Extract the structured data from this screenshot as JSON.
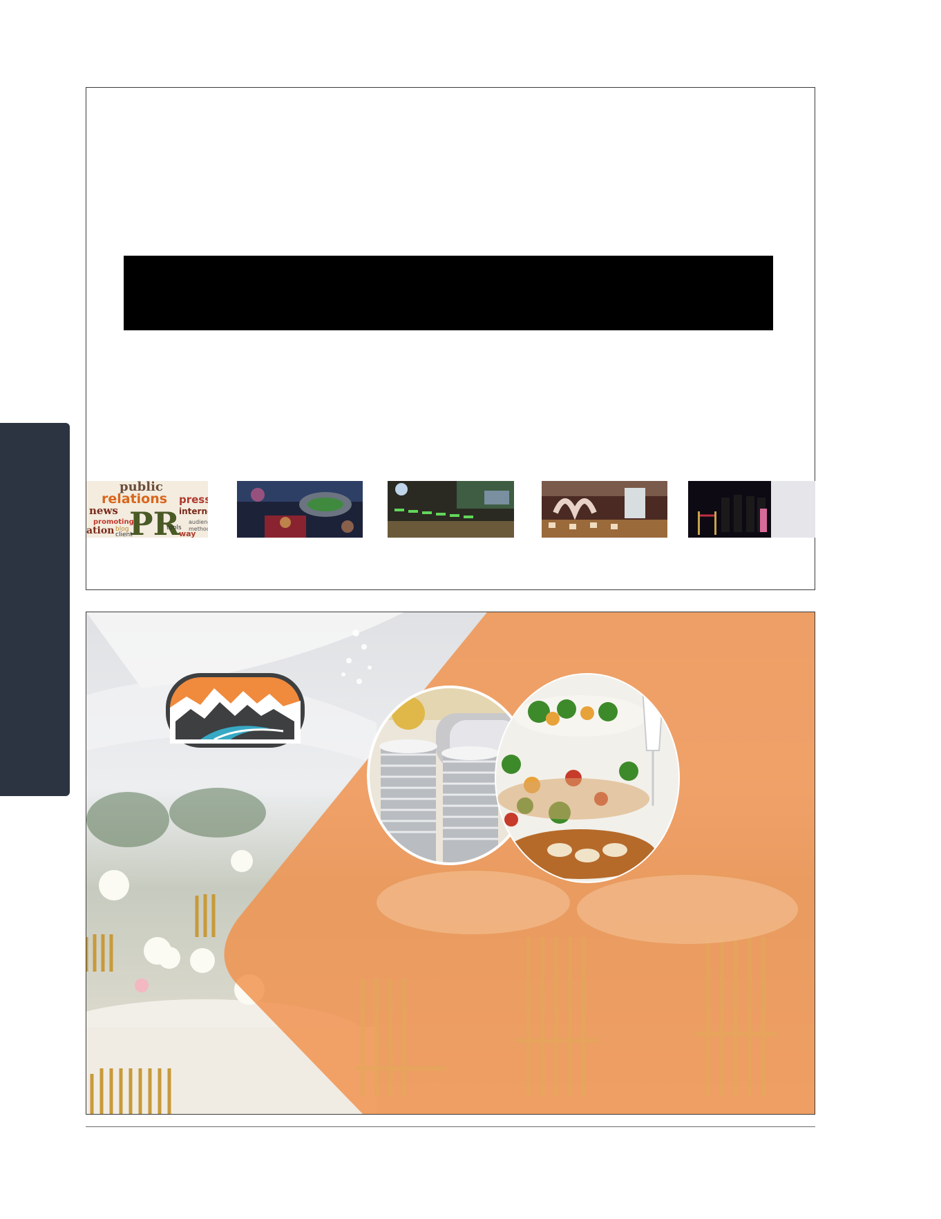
{
  "colors": {
    "side_tab": "#2b3440",
    "frame_border": "#3a3a3a",
    "redaction_bar": "#000000",
    "brand_orange": "#f0904a",
    "logo_dark": "#3d3f41",
    "logo_teal": "#37a9c4"
  },
  "thumbnails": [
    {
      "subject": "pr-word-cloud",
      "words": [
        "public",
        "relations",
        "press",
        "news",
        "PR",
        "promoting",
        "internet",
        "tools",
        "blog",
        "client",
        "audience",
        "methods",
        "way",
        "ation"
      ]
    },
    {
      "subject": "stadium-event"
    },
    {
      "subject": "stage-lighting-console"
    },
    {
      "subject": "exhibition-booth"
    },
    {
      "subject": "red-carpet-ceremony"
    }
  ],
  "banner": {
    "logo_icon": "mountain-river-logo",
    "circle_left_subject": "stacked-plates-buffet",
    "circle_right_subject": "catering-food-platter"
  }
}
